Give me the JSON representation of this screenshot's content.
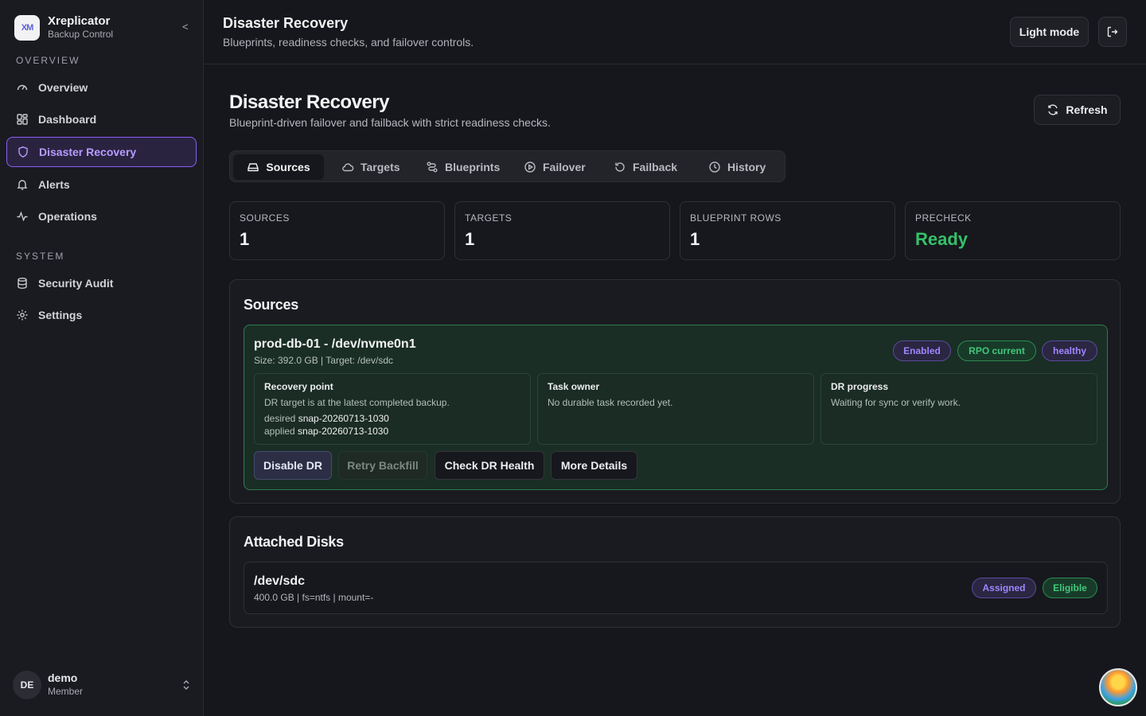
{
  "brand": {
    "name": "Xreplicator",
    "sub": "Backup Control",
    "logo_text": "XM",
    "collapse": "<"
  },
  "sidebar": {
    "sections": [
      {
        "label": "OVERVIEW"
      },
      {
        "label": "SYSTEM"
      }
    ],
    "items": [
      {
        "label": "Overview",
        "icon": "gauge-icon"
      },
      {
        "label": "Dashboard",
        "icon": "grid-icon"
      },
      {
        "label": "Disaster Recovery",
        "icon": "shield-icon",
        "active": true
      },
      {
        "label": "Alerts",
        "icon": "bell-icon"
      },
      {
        "label": "Operations",
        "icon": "activity-icon"
      },
      {
        "label": "Security Audit",
        "icon": "database-icon"
      },
      {
        "label": "Settings",
        "icon": "gear-icon"
      }
    ],
    "user": {
      "initials": "DE",
      "name": "demo",
      "role": "Member"
    }
  },
  "header": {
    "title": "Disaster Recovery",
    "subtitle": "Blueprints, readiness checks, and failover controls.",
    "theme_button": "Light mode"
  },
  "page": {
    "title": "Disaster Recovery",
    "subtitle": "Blueprint-driven failover and failback with strict readiness checks.",
    "refresh_label": "Refresh",
    "tabs": [
      {
        "label": "Sources",
        "icon": "drive-icon",
        "active": true
      },
      {
        "label": "Targets",
        "icon": "cloud-icon"
      },
      {
        "label": "Blueprints",
        "icon": "route-icon"
      },
      {
        "label": "Failover",
        "icon": "play-circle-icon"
      },
      {
        "label": "Failback",
        "icon": "rotate-ccw-icon"
      },
      {
        "label": "History",
        "icon": "clock-icon"
      }
    ],
    "stats": [
      {
        "label": "SOURCES",
        "value": "1"
      },
      {
        "label": "TARGETS",
        "value": "1"
      },
      {
        "label": "BLUEPRINT ROWS",
        "value": "1"
      },
      {
        "label": "PRECHECK",
        "value": "Ready",
        "color": "#34c16a"
      }
    ]
  },
  "sources": {
    "title": "Sources",
    "item": {
      "name": "prod-db-01 - /dev/nvme0n1",
      "meta": "Size: 392.0 GB | Target: /dev/sdc",
      "badges": [
        {
          "label": "Enabled",
          "tone": "purple"
        },
        {
          "label": "RPO current",
          "tone": "green"
        },
        {
          "label": "healthy",
          "tone": "purple"
        }
      ],
      "recovery_point": {
        "title": "Recovery point",
        "text": "DR target is at the latest completed backup.",
        "desired_label": "desired",
        "desired_value": "snap-20260713-1030",
        "applied_label": "applied",
        "applied_value": "snap-20260713-1030"
      },
      "task_owner": {
        "title": "Task owner",
        "text": "No durable task recorded yet."
      },
      "dr_progress": {
        "title": "DR progress",
        "text": "Waiting for sync or verify work."
      },
      "actions": [
        {
          "label": "Disable DR",
          "style": "primary"
        },
        {
          "label": "Retry Backfill",
          "style": "disabled"
        },
        {
          "label": "Check DR Health",
          "style": "default"
        },
        {
          "label": "More Details",
          "style": "default"
        }
      ]
    }
  },
  "disks": {
    "title": "Attached Disks",
    "item": {
      "name": "/dev/sdc",
      "meta": "400.0 GB | fs=ntfs | mount=-",
      "badges": [
        {
          "label": "Assigned",
          "tone": "purple"
        },
        {
          "label": "Eligible",
          "tone": "green"
        }
      ]
    }
  }
}
